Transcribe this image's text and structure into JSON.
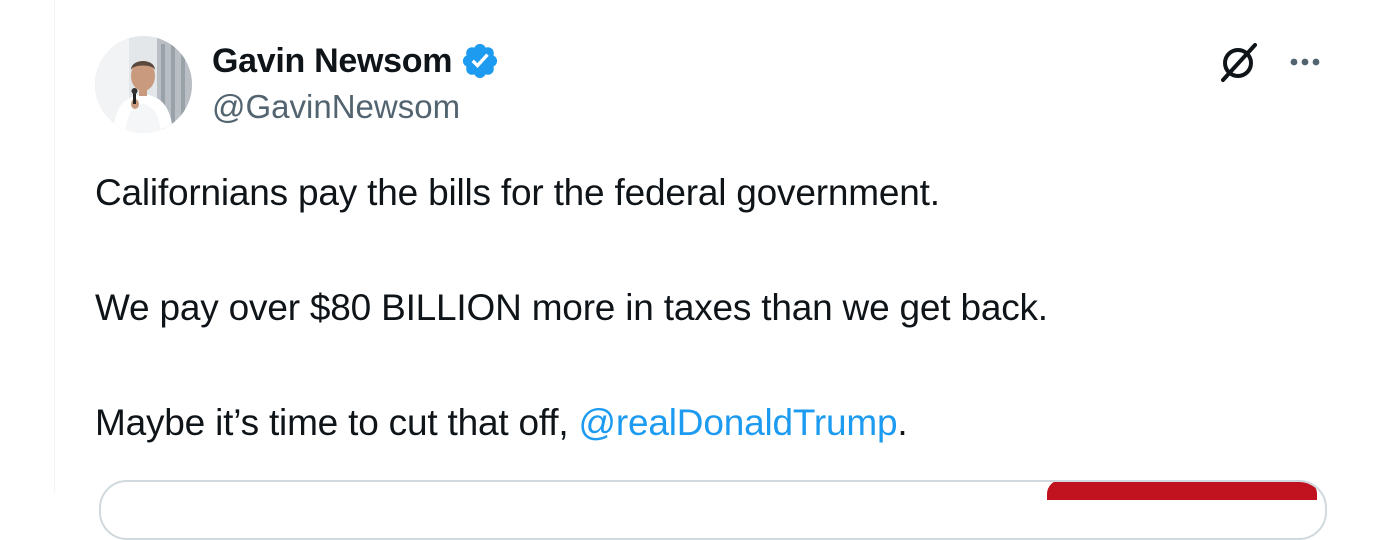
{
  "author": {
    "display_name": "Gavin Newsom",
    "handle": "@GavinNewsom",
    "verified": true,
    "avatar_icon": "profile-photo",
    "verified_color": "#1d9bf0"
  },
  "actions": {
    "grok_icon": "grok-slash-circle-icon",
    "more_icon": "more-dots-icon"
  },
  "tweet": {
    "line1": "Californians pay the bills for the federal government.",
    "line2": "We pay over $80 BILLION more in taxes than we get back.",
    "line3_prefix": "Maybe it’s time to cut that off, ",
    "mention": "@realDonaldTrump",
    "line3_suffix": ".",
    "mention_color": "#1d9bf0"
  },
  "colors": {
    "text": "#0f1419",
    "secondary": "#536471",
    "card_accent": "#c1121f"
  }
}
